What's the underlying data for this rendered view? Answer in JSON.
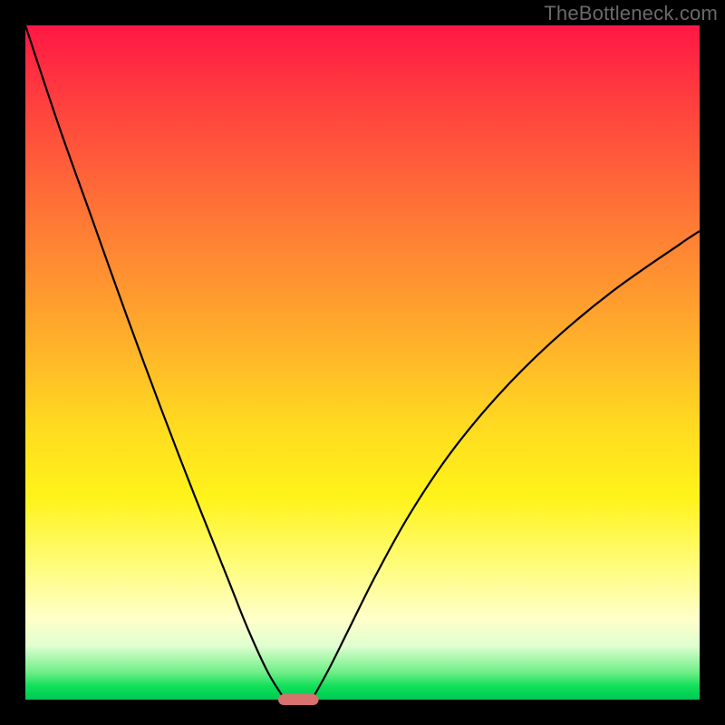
{
  "watermark": "TheBottleneck.com",
  "chart_data": {
    "type": "line",
    "title": "",
    "xlabel": "",
    "ylabel": "",
    "xrange": [
      0,
      100
    ],
    "yrange": [
      0,
      100
    ],
    "grid": false,
    "legend": false,
    "gradient_meaning": "top (red) = high bottleneck, bottom (green) = low bottleneck",
    "series": [
      {
        "name": "left-branch",
        "x": [
          0,
          5,
          10,
          15,
          20,
          25,
          30,
          33,
          36,
          38.5
        ],
        "y": [
          100,
          85,
          71,
          57,
          43.5,
          30.5,
          18,
          10.5,
          4,
          0
        ]
      },
      {
        "name": "right-branch",
        "x": [
          42.5,
          45,
          48,
          52,
          57,
          63,
          70,
          78,
          87,
          97,
          100
        ],
        "y": [
          0,
          4.5,
          10.5,
          18.5,
          27.5,
          36.5,
          45,
          53,
          60.5,
          67.5,
          69.5
        ]
      }
    ],
    "marker": {
      "x_range": [
        37.5,
        43.5
      ],
      "y": 0,
      "color": "#d9716e"
    },
    "colors": {
      "gradient_top": "#ff1744",
      "gradient_mid": "#ffdc20",
      "gradient_bottom": "#00c853",
      "curve": "#000000",
      "frame": "#000000"
    }
  }
}
